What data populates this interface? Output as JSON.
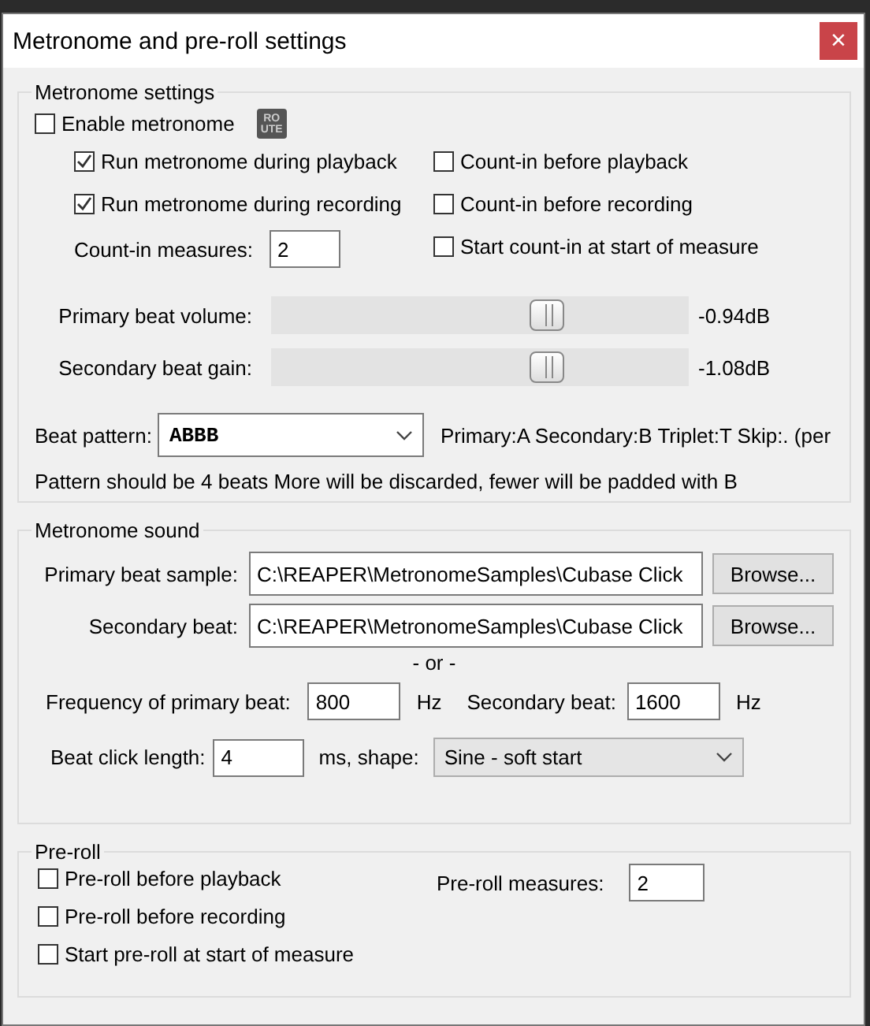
{
  "window": {
    "title": "Metronome and pre-roll settings",
    "close": "×"
  },
  "metronome_settings": {
    "title": "Metronome settings",
    "enable": {
      "label": "Enable metronome",
      "checked": false
    },
    "route_icon": [
      "RO",
      "UTE"
    ],
    "left_options": [
      {
        "label": "Run metronome during playback",
        "checked": true
      },
      {
        "label": "Run metronome during recording",
        "checked": true
      }
    ],
    "count_in_measures": {
      "label": "Count-in measures:",
      "value": "2"
    },
    "right_options": [
      {
        "label": "Count-in before playback",
        "checked": false
      },
      {
        "label": "Count-in before recording",
        "checked": false
      },
      {
        "label": "Start count-in at start of measure",
        "checked": false
      }
    ],
    "sliders": [
      {
        "label": "Primary beat volume:",
        "level": 0.66,
        "reading": "-0.94dB"
      },
      {
        "label": "Secondary beat gain:",
        "level": 0.66,
        "reading": "-1.08dB"
      }
    ],
    "beat_pattern": {
      "label": "Beat pattern:",
      "value": "ABBB",
      "hint": "Primary:A Secondary:B Triplet:T Skip:. (per"
    },
    "note": "Pattern should be 4 beats More will be discarded, fewer will be padded with B"
  },
  "metronome_sound": {
    "title": "Metronome sound",
    "samples": [
      {
        "label": "Primary beat sample:",
        "value": "C:\\REAPER\\MetronomeSamples\\Cubase Click",
        "button": "Browse..."
      },
      {
        "label": "Secondary beat:",
        "value": "C:\\REAPER\\MetronomeSamples\\Cubase Click",
        "button": "Browse..."
      }
    ],
    "separator": "- or -",
    "frequencies": [
      {
        "label": "Frequency of primary beat:",
        "value": "800",
        "unit": "Hz"
      },
      {
        "label": "Secondary beat:",
        "value": "1600",
        "unit": "Hz"
      }
    ],
    "click_length": {
      "label": "Beat click length:",
      "value": "4",
      "unit": "ms, shape:"
    },
    "shape": {
      "value": "Sine - soft start"
    }
  },
  "pre_roll": {
    "title": "Pre-roll",
    "options": [
      {
        "label": "Pre-roll before playback",
        "checked": false
      },
      {
        "label": "Pre-roll before recording",
        "checked": false
      },
      {
        "label": "Start pre-roll at start of measure",
        "checked": false
      }
    ],
    "measures": {
      "label": "Pre-roll measures:",
      "value": "2"
    }
  }
}
